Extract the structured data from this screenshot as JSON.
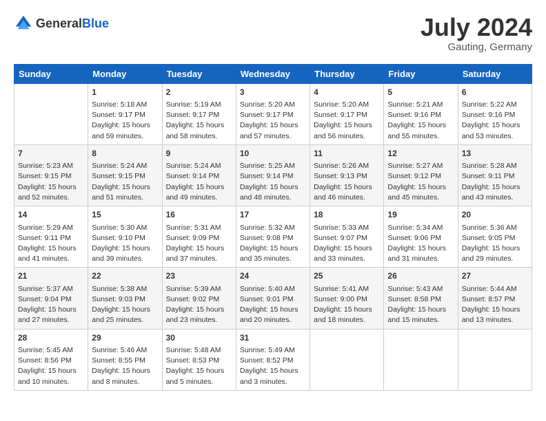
{
  "header": {
    "logo_general": "General",
    "logo_blue": "Blue",
    "month_year": "July 2024",
    "location": "Gauting, Germany"
  },
  "calendar": {
    "days_of_week": [
      "Sunday",
      "Monday",
      "Tuesday",
      "Wednesday",
      "Thursday",
      "Friday",
      "Saturday"
    ],
    "rows": [
      [
        {
          "day": "",
          "sunrise": "",
          "sunset": "",
          "daylight": ""
        },
        {
          "day": "1",
          "sunrise": "Sunrise: 5:18 AM",
          "sunset": "Sunset: 9:17 PM",
          "daylight": "Daylight: 15 hours and 59 minutes."
        },
        {
          "day": "2",
          "sunrise": "Sunrise: 5:19 AM",
          "sunset": "Sunset: 9:17 PM",
          "daylight": "Daylight: 15 hours and 58 minutes."
        },
        {
          "day": "3",
          "sunrise": "Sunrise: 5:20 AM",
          "sunset": "Sunset: 9:17 PM",
          "daylight": "Daylight: 15 hours and 57 minutes."
        },
        {
          "day": "4",
          "sunrise": "Sunrise: 5:20 AM",
          "sunset": "Sunset: 9:17 PM",
          "daylight": "Daylight: 15 hours and 56 minutes."
        },
        {
          "day": "5",
          "sunrise": "Sunrise: 5:21 AM",
          "sunset": "Sunset: 9:16 PM",
          "daylight": "Daylight: 15 hours and 55 minutes."
        },
        {
          "day": "6",
          "sunrise": "Sunrise: 5:22 AM",
          "sunset": "Sunset: 9:16 PM",
          "daylight": "Daylight: 15 hours and 53 minutes."
        }
      ],
      [
        {
          "day": "7",
          "sunrise": "Sunrise: 5:23 AM",
          "sunset": "Sunset: 9:15 PM",
          "daylight": "Daylight: 15 hours and 52 minutes."
        },
        {
          "day": "8",
          "sunrise": "Sunrise: 5:24 AM",
          "sunset": "Sunset: 9:15 PM",
          "daylight": "Daylight: 15 hours and 51 minutes."
        },
        {
          "day": "9",
          "sunrise": "Sunrise: 5:24 AM",
          "sunset": "Sunset: 9:14 PM",
          "daylight": "Daylight: 15 hours and 49 minutes."
        },
        {
          "day": "10",
          "sunrise": "Sunrise: 5:25 AM",
          "sunset": "Sunset: 9:14 PM",
          "daylight": "Daylight: 15 hours and 48 minutes."
        },
        {
          "day": "11",
          "sunrise": "Sunrise: 5:26 AM",
          "sunset": "Sunset: 9:13 PM",
          "daylight": "Daylight: 15 hours and 46 minutes."
        },
        {
          "day": "12",
          "sunrise": "Sunrise: 5:27 AM",
          "sunset": "Sunset: 9:12 PM",
          "daylight": "Daylight: 15 hours and 45 minutes."
        },
        {
          "day": "13",
          "sunrise": "Sunrise: 5:28 AM",
          "sunset": "Sunset: 9:11 PM",
          "daylight": "Daylight: 15 hours and 43 minutes."
        }
      ],
      [
        {
          "day": "14",
          "sunrise": "Sunrise: 5:29 AM",
          "sunset": "Sunset: 9:11 PM",
          "daylight": "Daylight: 15 hours and 41 minutes."
        },
        {
          "day": "15",
          "sunrise": "Sunrise: 5:30 AM",
          "sunset": "Sunset: 9:10 PM",
          "daylight": "Daylight: 15 hours and 39 minutes."
        },
        {
          "day": "16",
          "sunrise": "Sunrise: 5:31 AM",
          "sunset": "Sunset: 9:09 PM",
          "daylight": "Daylight: 15 hours and 37 minutes."
        },
        {
          "day": "17",
          "sunrise": "Sunrise: 5:32 AM",
          "sunset": "Sunset: 9:08 PM",
          "daylight": "Daylight: 15 hours and 35 minutes."
        },
        {
          "day": "18",
          "sunrise": "Sunrise: 5:33 AM",
          "sunset": "Sunset: 9:07 PM",
          "daylight": "Daylight: 15 hours and 33 minutes."
        },
        {
          "day": "19",
          "sunrise": "Sunrise: 5:34 AM",
          "sunset": "Sunset: 9:06 PM",
          "daylight": "Daylight: 15 hours and 31 minutes."
        },
        {
          "day": "20",
          "sunrise": "Sunrise: 5:36 AM",
          "sunset": "Sunset: 9:05 PM",
          "daylight": "Daylight: 15 hours and 29 minutes."
        }
      ],
      [
        {
          "day": "21",
          "sunrise": "Sunrise: 5:37 AM",
          "sunset": "Sunset: 9:04 PM",
          "daylight": "Daylight: 15 hours and 27 minutes."
        },
        {
          "day": "22",
          "sunrise": "Sunrise: 5:38 AM",
          "sunset": "Sunset: 9:03 PM",
          "daylight": "Daylight: 15 hours and 25 minutes."
        },
        {
          "day": "23",
          "sunrise": "Sunrise: 5:39 AM",
          "sunset": "Sunset: 9:02 PM",
          "daylight": "Daylight: 15 hours and 23 minutes."
        },
        {
          "day": "24",
          "sunrise": "Sunrise: 5:40 AM",
          "sunset": "Sunset: 9:01 PM",
          "daylight": "Daylight: 15 hours and 20 minutes."
        },
        {
          "day": "25",
          "sunrise": "Sunrise: 5:41 AM",
          "sunset": "Sunset: 9:00 PM",
          "daylight": "Daylight: 15 hours and 18 minutes."
        },
        {
          "day": "26",
          "sunrise": "Sunrise: 5:43 AM",
          "sunset": "Sunset: 8:58 PM",
          "daylight": "Daylight: 15 hours and 15 minutes."
        },
        {
          "day": "27",
          "sunrise": "Sunrise: 5:44 AM",
          "sunset": "Sunset: 8:57 PM",
          "daylight": "Daylight: 15 hours and 13 minutes."
        }
      ],
      [
        {
          "day": "28",
          "sunrise": "Sunrise: 5:45 AM",
          "sunset": "Sunset: 8:56 PM",
          "daylight": "Daylight: 15 hours and 10 minutes."
        },
        {
          "day": "29",
          "sunrise": "Sunrise: 5:46 AM",
          "sunset": "Sunset: 8:55 PM",
          "daylight": "Daylight: 15 hours and 8 minutes."
        },
        {
          "day": "30",
          "sunrise": "Sunrise: 5:48 AM",
          "sunset": "Sunset: 8:53 PM",
          "daylight": "Daylight: 15 hours and 5 minutes."
        },
        {
          "day": "31",
          "sunrise": "Sunrise: 5:49 AM",
          "sunset": "Sunset: 8:52 PM",
          "daylight": "Daylight: 15 hours and 3 minutes."
        },
        {
          "day": "",
          "sunrise": "",
          "sunset": "",
          "daylight": ""
        },
        {
          "day": "",
          "sunrise": "",
          "sunset": "",
          "daylight": ""
        },
        {
          "day": "",
          "sunrise": "",
          "sunset": "",
          "daylight": ""
        }
      ]
    ]
  }
}
